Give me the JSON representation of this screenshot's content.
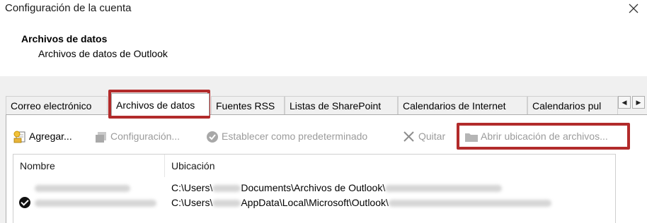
{
  "window": {
    "title": "Configuración de la cuenta",
    "close_glyph": "✕"
  },
  "header": {
    "title": "Archivos de datos",
    "subtitle": "Archivos de datos de Outlook"
  },
  "tabs": [
    {
      "label": "Correo electrónico",
      "active": false
    },
    {
      "label": "Archivos de datos",
      "active": true
    },
    {
      "label": "Fuentes RSS",
      "active": false
    },
    {
      "label": "Listas de SharePoint",
      "active": false
    },
    {
      "label": "Calendarios de Internet",
      "active": false
    },
    {
      "label": "Calendarios pul",
      "active": false
    }
  ],
  "tab_scroll": {
    "left": "◀",
    "right": "▶"
  },
  "toolbar": {
    "add": {
      "label": "Agregar...",
      "enabled": true,
      "icon": "add-data-file-icon"
    },
    "settings": {
      "label": "Configuración...",
      "enabled": false,
      "icon": "settings-icon"
    },
    "set_default": {
      "label": "Establecer como predeterminado",
      "enabled": false,
      "icon": "check-circle-icon"
    },
    "remove": {
      "label": "Quitar",
      "enabled": false,
      "icon": "close-icon"
    },
    "open_location": {
      "label": "Abrir ubicación de archivos...",
      "enabled": false,
      "icon": "folder-icon"
    }
  },
  "highlight_color": "#b22b2b",
  "list": {
    "columns": [
      "Nombre",
      "Ubicación"
    ],
    "rows": [
      {
        "default": false,
        "location_prefix": "C:\\Users\\",
        "location_mid": "Documents\\Archivos de Outlook\\"
      },
      {
        "default": true,
        "location_prefix": "C:\\Users\\",
        "location_mid": "AppData\\Local\\Microsoft\\Outlook\\"
      }
    ]
  }
}
